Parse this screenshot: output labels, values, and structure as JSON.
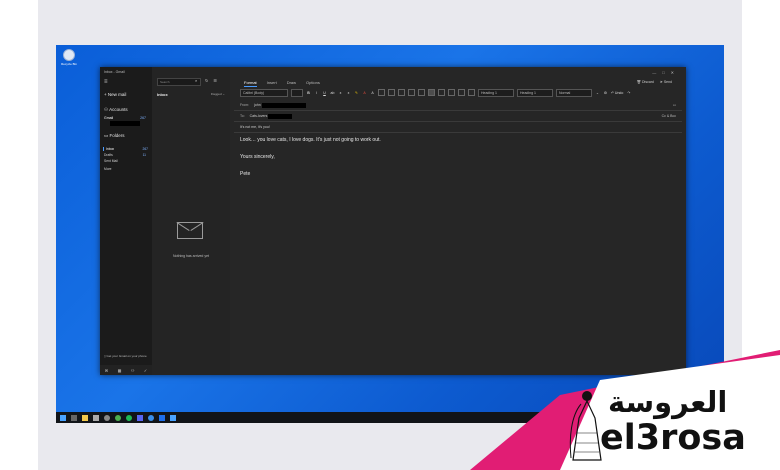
{
  "desktop": {
    "icon_label": "Recycle Bin"
  },
  "window": {
    "title": "Inbox - Gmail",
    "controls": [
      "—",
      "□",
      "✕"
    ]
  },
  "nav": {
    "new_mail": "New mail",
    "accounts_header": "Accounts",
    "account": {
      "name": "Gmail",
      "count": "267"
    },
    "folders_header": "Folders",
    "folders": [
      {
        "label": "Inbox",
        "count": "267"
      },
      {
        "label": "Drafts",
        "count": "11"
      },
      {
        "label": "Sent Mail",
        "count": ""
      },
      {
        "label": "More",
        "count": ""
      }
    ],
    "phone_promo": "Get your Gmail on your phone"
  },
  "list": {
    "search_placeholder": "Search",
    "header": "Inbox",
    "filter": "Flagged",
    "empty_message": "Nothing has arrived yet"
  },
  "compose": {
    "tabs": [
      "Format",
      "Insert",
      "Draw",
      "Options"
    ],
    "actions": {
      "discard": "Discard",
      "send": "Send"
    },
    "ribbon": {
      "font": "Calibri (Body)",
      "heading_dropdown": "Heading 1",
      "heading2_dropdown": "Heading 1",
      "style_dropdown": "Normal",
      "undo": "Undo"
    },
    "from_label": "From:",
    "from_value": "john",
    "to_label": "To:",
    "to_value": "Cats-lovers",
    "cc_bcc": "Cc & Bcc",
    "subject": "It's not me, it's you!",
    "body": [
      "Look… you love cats, I love dogs. It's just not going to work out.",
      "Yours sincerely,",
      "Pete"
    ]
  },
  "branding": {
    "arabic": "العروسة",
    "latin": "el3rosa"
  },
  "colors": {
    "accent": "#4a9cff",
    "brand_pink": "#e11d74",
    "window_bg": "#2b2b2b",
    "desktop_blue": "#1a74e8"
  }
}
